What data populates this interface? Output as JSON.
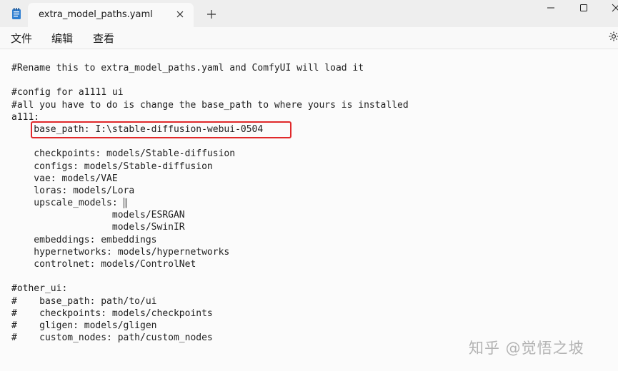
{
  "window": {
    "tab_title": "extra_model_paths.yaml",
    "new_tab_glyph": "+",
    "icons": [
      "notepad-icon",
      "close-icon",
      "plus-icon",
      "minimize-icon",
      "maximize-icon",
      "close-window-icon"
    ]
  },
  "menu": {
    "items": [
      "文件",
      "编辑",
      "查看"
    ],
    "settings_icon": "gear-icon"
  },
  "editor": {
    "lines": [
      "#Rename this to extra_model_paths.yaml and ComfyUI will load it",
      "",
      "#config for a1111 ui",
      "#all you have to do is change the base_path to where yours is installed",
      "a111:",
      "    base_path: I:\\stable-diffusion-webui-0504",
      "",
      "    checkpoints: models/Stable-diffusion",
      "    configs: models/Stable-diffusion",
      "    vae: models/VAE",
      "    loras: models/Lora",
      "    upscale_models: |",
      "                  models/ESRGAN",
      "                  models/SwinIR",
      "    embeddings: embeddings",
      "    hypernetworks: models/hypernetworks",
      "    controlnet: models/ControlNet",
      "",
      "#other_ui:",
      "#    base_path: path/to/ui",
      "#    checkpoints: models/checkpoints",
      "#    gligen: models/gligen",
      "#    custom_nodes: path/custom_nodes"
    ],
    "highlight_color": "#e0282a"
  },
  "watermark": "知乎 @觉悟之坡"
}
